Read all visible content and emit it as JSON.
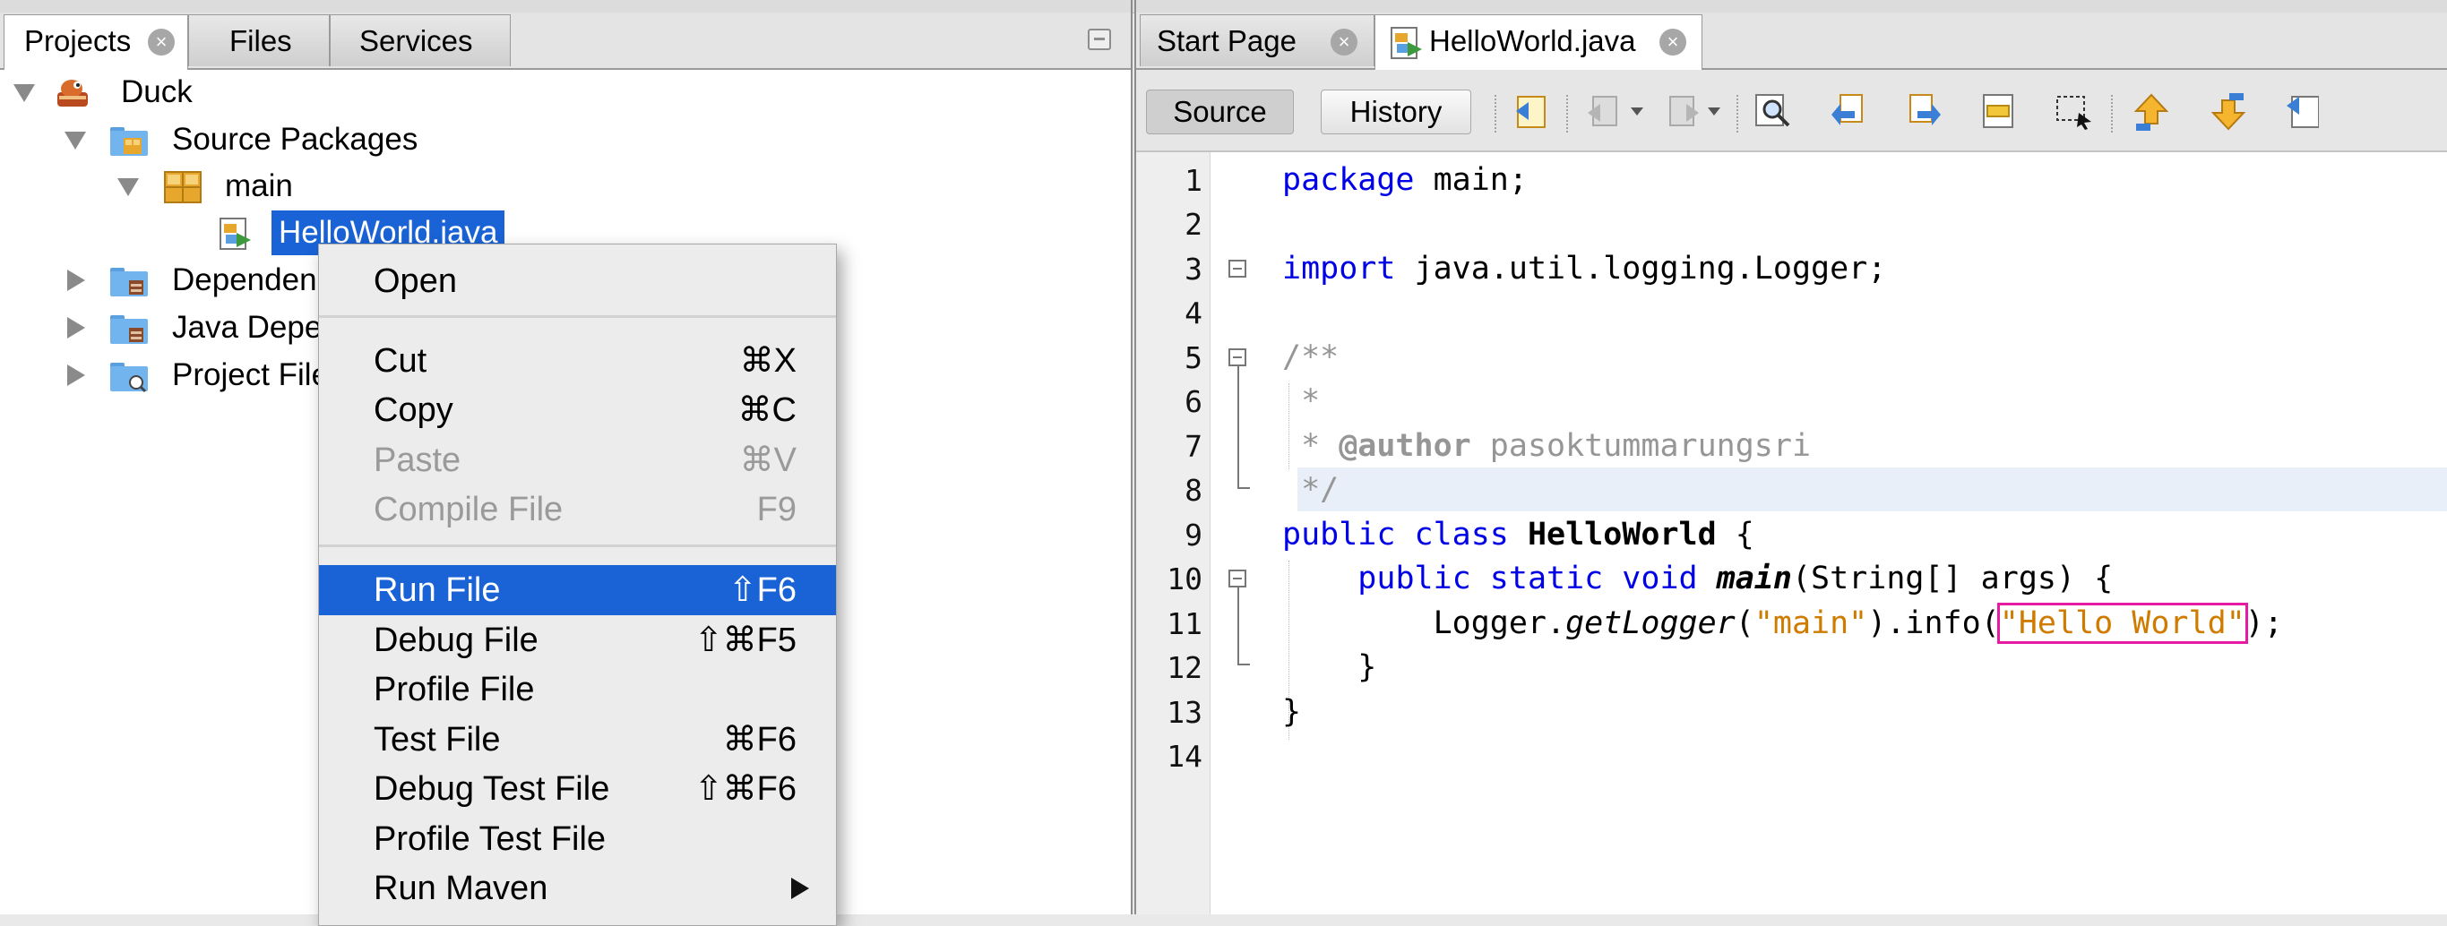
{
  "projects_panel": {
    "tabs": [
      {
        "label": "Projects",
        "active": true,
        "closable": true
      },
      {
        "label": "Files",
        "active": false,
        "closable": false
      },
      {
        "label": "Services",
        "active": false,
        "closable": false
      }
    ],
    "tree": [
      {
        "label": "Duck",
        "icon": "duck-project-icon",
        "expanded": true
      },
      {
        "label": "Source Packages",
        "icon": "source-packages-folder-icon",
        "expanded": true
      },
      {
        "label": "main",
        "icon": "package-icon",
        "expanded": true
      },
      {
        "label": "HelloWorld.java",
        "icon": "java-file-icon",
        "selected": true
      },
      {
        "label": "Dependencies",
        "icon": "dependencies-folder-icon",
        "expanded": false
      },
      {
        "label": "Java Dependencies",
        "icon": "java-dependencies-folder-icon",
        "expanded": false
      },
      {
        "label": "Project Files",
        "icon": "project-files-folder-icon",
        "expanded": false
      }
    ]
  },
  "context_menu": {
    "items": [
      {
        "label": "Open",
        "shortcut": "",
        "enabled": true
      },
      {
        "label": "Cut",
        "shortcut": "⌘X",
        "enabled": true
      },
      {
        "label": "Copy",
        "shortcut": "⌘C",
        "enabled": true
      },
      {
        "label": "Paste",
        "shortcut": "⌘V",
        "enabled": false
      },
      {
        "label": "Compile File",
        "shortcut": "F9",
        "enabled": false
      },
      {
        "label": "Run File",
        "shortcut": "⇧F6",
        "enabled": true,
        "highlighted": true
      },
      {
        "label": "Debug File",
        "shortcut": "⇧⌘F5",
        "enabled": true
      },
      {
        "label": "Profile File",
        "shortcut": "",
        "enabled": true
      },
      {
        "label": "Test File",
        "shortcut": "⌘F6",
        "enabled": true
      },
      {
        "label": "Debug Test File",
        "shortcut": "⇧⌘F6",
        "enabled": true
      },
      {
        "label": "Profile Test File",
        "shortcut": "",
        "enabled": true
      },
      {
        "label": "Run Maven",
        "shortcut": "",
        "enabled": true,
        "submenu": true
      }
    ]
  },
  "editor": {
    "tabs": [
      {
        "label": "Start Page",
        "active": false
      },
      {
        "label": "HelloWorld.java",
        "active": true
      }
    ],
    "toolbar": {
      "source_label": "Source",
      "history_label": "History"
    },
    "line_numbers": [
      "1",
      "2",
      "3",
      "4",
      "5",
      "6",
      "7",
      "8",
      "9",
      "10",
      "11",
      "12",
      "13",
      "14"
    ],
    "code": {
      "l1_kw": "package",
      "l1_rest": " main;",
      "l3_kw": "import",
      "l3_rest": " java.util.logging.Logger;",
      "l5": "/**",
      "l6": " *",
      "l7_a": " * ",
      "l7_tag": "@author",
      "l7_b": " pasoktummarungsri",
      "l8": " */",
      "l9_kw": "public class",
      "l9_sp": " ",
      "l9_name": "HelloWorld",
      "l9_end": " {",
      "l10_ind": "    ",
      "l10_kw": "public static void",
      "l10_sp": " ",
      "l10_name": "main",
      "l10_end": "(String[] args) {",
      "l11_ind": "        ",
      "l11_a": "Logger.",
      "l11_m": "getLogger",
      "l11_b": "(",
      "l11_s1": "\"main\"",
      "l11_c": ").info(",
      "l11_s2": "\"Hello World\"",
      "l11_d": ");",
      "l12": "    }",
      "l13": "}"
    },
    "current_line": 8
  },
  "colors": {
    "selection": "#1a63d6",
    "keyword": "#0000e6",
    "string": "#ce7b00",
    "comment": "#969696",
    "highlight_box": "#e61aa3"
  }
}
